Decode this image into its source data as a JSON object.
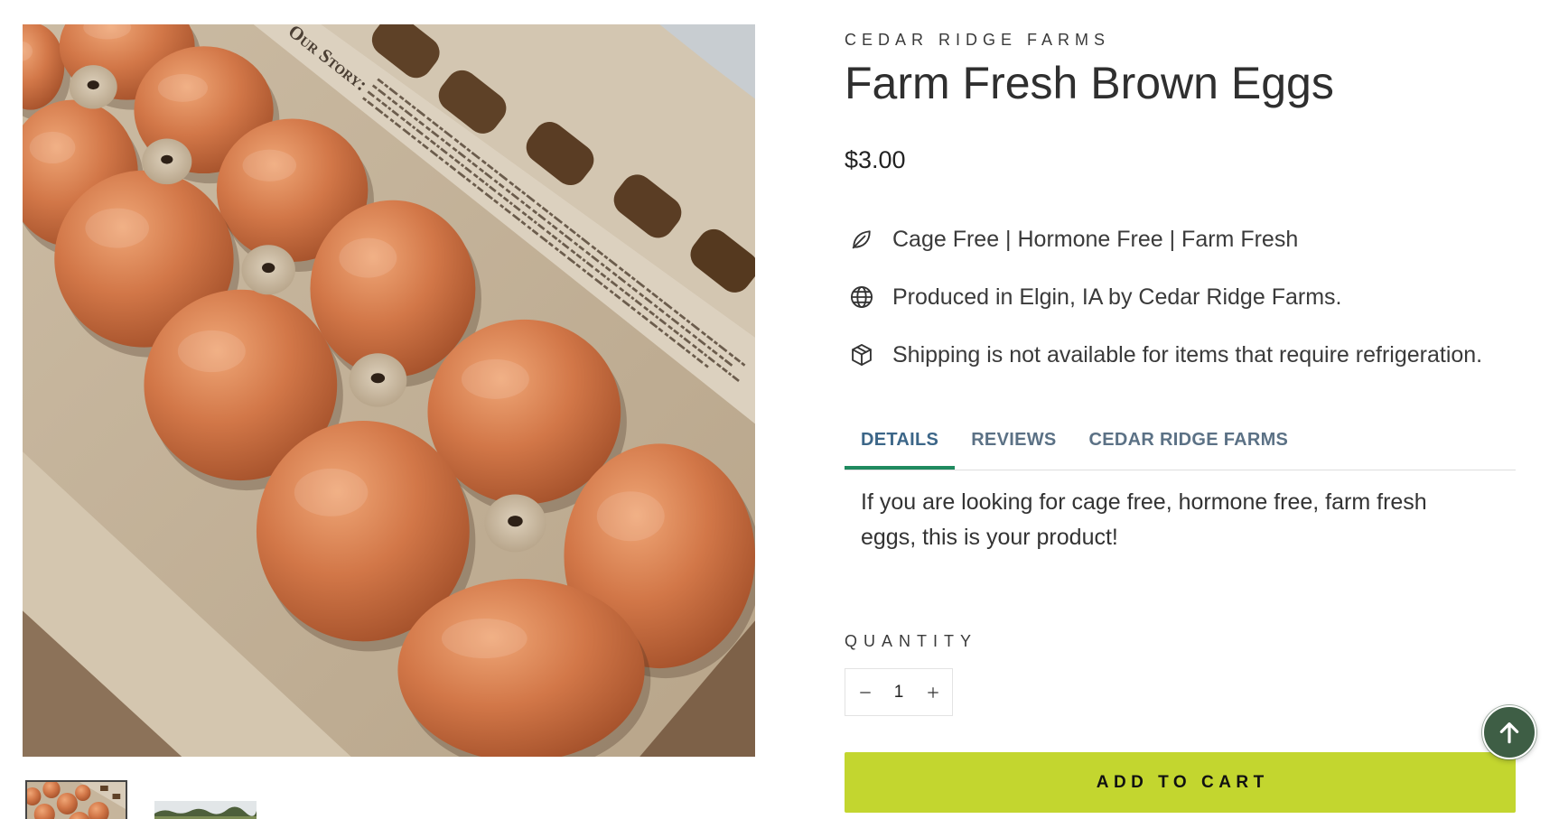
{
  "product": {
    "vendor": "CEDAR RIDGE FARMS",
    "title": "Farm Fresh Brown Eggs",
    "price": "$3.00",
    "image": {
      "carton_text": "Our Story:"
    },
    "features": [
      {
        "icon": "leaf-icon",
        "text": "Cage Free | Hormone Free | Farm Fresh"
      },
      {
        "icon": "globe-icon",
        "text": "Produced in Elgin, IA by Cedar Ridge Farms."
      },
      {
        "icon": "box-icon",
        "text": "Shipping is not available for items that require refrigeration."
      }
    ]
  },
  "gallery": {
    "selected_index": 0
  },
  "tabs": [
    {
      "label": "DETAILS",
      "active": true
    },
    {
      "label": "REVIEWS",
      "active": false
    },
    {
      "label": "CEDAR RIDGE FARMS",
      "active": false
    }
  ],
  "details": {
    "text": "If you are looking for cage free, hormone free, farm fresh eggs, this is your product!"
  },
  "quantity": {
    "label": "QUANTITY",
    "value": "1",
    "decrease_icon": "minus-icon",
    "increase_icon": "plus-icon"
  },
  "cart": {
    "add_label": "ADD TO CART"
  },
  "back_to_top": {
    "icon": "arrow-up-icon"
  },
  "colors": {
    "text": "#333333",
    "tab_text": "#5b7185",
    "tab_active_text": "#3c6688",
    "tab_active_underline": "#1f8a5f",
    "add_to_cart_bg": "#c3d62f",
    "back_to_top_bg": "#3e5e45"
  }
}
